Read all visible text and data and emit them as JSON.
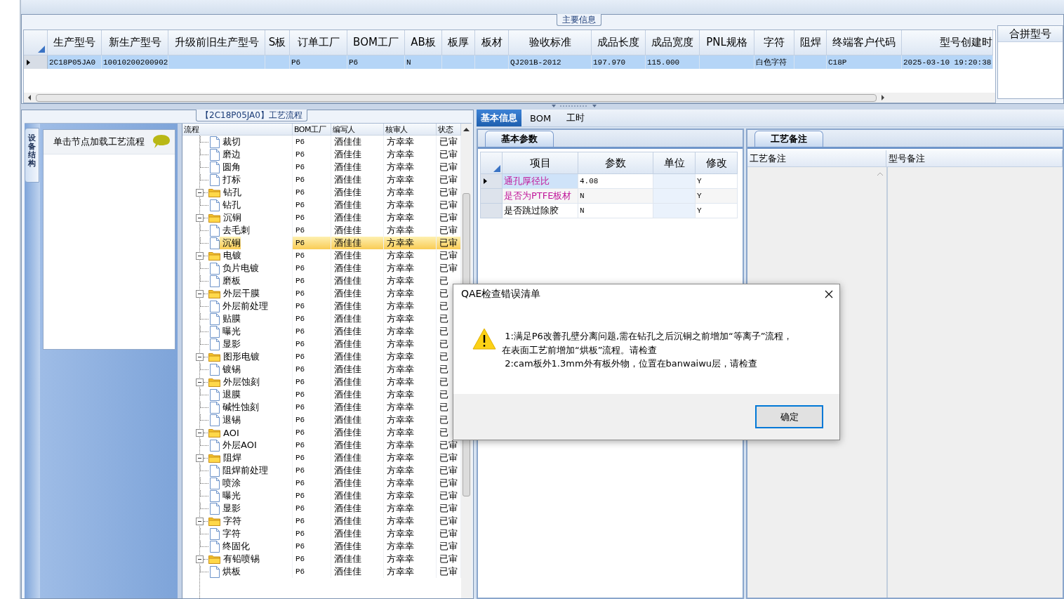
{
  "main_info": {
    "title": "主要信息",
    "columns": [
      "生产型号",
      "新生产型号",
      "升级前旧生产型号",
      "S板",
      "订单工厂",
      "BOM工厂",
      "AB板",
      "板厚",
      "板材",
      "验收标准",
      "成品长度",
      "成品宽度",
      "PNL规格",
      "字符",
      "阻焊",
      "终端客户代码",
      "型号创建时"
    ],
    "rows": [
      {
        "selected": true,
        "cells": [
          "2C18P05JA0",
          "10010200200902",
          "",
          "",
          "P6",
          "P6",
          "N",
          "",
          "",
          "QJ201B-2012",
          "197.970",
          "115.000",
          "",
          "白色字符",
          "",
          "C18P",
          "2025-03-10 19:20:38"
        ]
      }
    ],
    "merge_header": "合拼型号"
  },
  "process_panel": {
    "title": "【2C18P05JA0】工艺流程",
    "side_tab": "设备结构",
    "node_hint": "单击节点加载工艺流程",
    "columns": [
      "流程",
      "BOM工厂",
      "编写人",
      "核审人",
      "状态"
    ],
    "items": [
      {
        "children": [
          {
            "label": "裁切",
            "bom": "P6",
            "writer": "酒佳佳",
            "reviewer": "方幸幸",
            "status": "已审",
            "selected": false
          },
          {
            "label": "磨边",
            "bom": "P6",
            "writer": "酒佳佳",
            "reviewer": "方幸幸",
            "status": "已审",
            "selected": false
          },
          {
            "label": "圆角",
            "bom": "P6",
            "writer": "酒佳佳",
            "reviewer": "方幸幸",
            "status": "已审",
            "selected": false
          },
          {
            "label": "打标",
            "bom": "P6",
            "writer": "酒佳佳",
            "reviewer": "方幸幸",
            "status": "已审",
            "selected": false
          }
        ]
      },
      {
        "label": "钻孔",
        "bom": "P6",
        "writer": "酒佳佳",
        "reviewer": "方幸幸",
        "status": "已审",
        "selected": false,
        "expanded": true,
        "children": [
          {
            "label": "钻孔",
            "bom": "P6",
            "writer": "酒佳佳",
            "reviewer": "方幸幸",
            "status": "已审",
            "selected": false
          }
        ]
      },
      {
        "label": "沉铜",
        "bom": "P6",
        "writer": "酒佳佳",
        "reviewer": "方幸幸",
        "status": "已审",
        "selected": false,
        "expanded": true,
        "children": [
          {
            "label": "去毛刺",
            "bom": "P6",
            "writer": "酒佳佳",
            "reviewer": "方幸幸",
            "status": "已审",
            "selected": false
          },
          {
            "label": "沉铜",
            "bom": "P6",
            "writer": "酒佳佳",
            "reviewer": "方幸幸",
            "status": "已审",
            "selected": true
          }
        ]
      },
      {
        "label": "电镀",
        "bom": "P6",
        "writer": "酒佳佳",
        "reviewer": "方幸幸",
        "status": "已审",
        "selected": false,
        "expanded": true,
        "children": [
          {
            "label": "负片电镀",
            "bom": "P6",
            "writer": "酒佳佳",
            "reviewer": "方幸幸",
            "status": "已审",
            "selected": false
          },
          {
            "label": "磨板",
            "bom": "P6",
            "writer": "酒佳佳",
            "reviewer": "方幸幸",
            "status": "已",
            "selected": false
          }
        ]
      },
      {
        "label": "外层干膜",
        "bom": "P6",
        "writer": "酒佳佳",
        "reviewer": "方幸幸",
        "status": "已",
        "selected": false,
        "expanded": true,
        "children": [
          {
            "label": "外层前处理",
            "bom": "P6",
            "writer": "酒佳佳",
            "reviewer": "方幸幸",
            "status": "已",
            "selected": false
          },
          {
            "label": "贴膜",
            "bom": "P6",
            "writer": "酒佳佳",
            "reviewer": "方幸幸",
            "status": "已",
            "selected": false
          },
          {
            "label": "曝光",
            "bom": "P6",
            "writer": "酒佳佳",
            "reviewer": "方幸幸",
            "status": "已",
            "selected": false
          },
          {
            "label": "显影",
            "bom": "P6",
            "writer": "酒佳佳",
            "reviewer": "方幸幸",
            "status": "已",
            "selected": false
          }
        ]
      },
      {
        "label": "图形电镀",
        "bom": "P6",
        "writer": "酒佳佳",
        "reviewer": "方幸幸",
        "status": "已",
        "selected": false,
        "expanded": true,
        "children": [
          {
            "label": "镀锡",
            "bom": "P6",
            "writer": "酒佳佳",
            "reviewer": "方幸幸",
            "status": "已",
            "selected": false
          }
        ]
      },
      {
        "label": "外层蚀刻",
        "bom": "P6",
        "writer": "酒佳佳",
        "reviewer": "方幸幸",
        "status": "已",
        "selected": false,
        "expanded": true,
        "children": [
          {
            "label": "退膜",
            "bom": "P6",
            "writer": "酒佳佳",
            "reviewer": "方幸幸",
            "status": "已",
            "selected": false
          },
          {
            "label": "碱性蚀刻",
            "bom": "P6",
            "writer": "酒佳佳",
            "reviewer": "方幸幸",
            "status": "已",
            "selected": false
          },
          {
            "label": "退锡",
            "bom": "P6",
            "writer": "酒佳佳",
            "reviewer": "方幸幸",
            "status": "已",
            "selected": false
          }
        ]
      },
      {
        "label": "AOI",
        "bom": "P6",
        "writer": "酒佳佳",
        "reviewer": "方幸幸",
        "status": "已",
        "selected": false,
        "expanded": true,
        "children": [
          {
            "label": "外层AOI",
            "bom": "P6",
            "writer": "酒佳佳",
            "reviewer": "方幸幸",
            "status": "已审",
            "selected": false
          }
        ]
      },
      {
        "label": "阻焊",
        "bom": "P6",
        "writer": "酒佳佳",
        "reviewer": "方幸幸",
        "status": "已审",
        "selected": false,
        "expanded": true,
        "children": [
          {
            "label": "阻焊前处理",
            "bom": "P6",
            "writer": "酒佳佳",
            "reviewer": "方幸幸",
            "status": "已审",
            "selected": false
          },
          {
            "label": "喷涂",
            "bom": "P6",
            "writer": "酒佳佳",
            "reviewer": "方幸幸",
            "status": "已审",
            "selected": false
          },
          {
            "label": "曝光",
            "bom": "P6",
            "writer": "酒佳佳",
            "reviewer": "方幸幸",
            "status": "已审",
            "selected": false
          },
          {
            "label": "显影",
            "bom": "P6",
            "writer": "酒佳佳",
            "reviewer": "方幸幸",
            "status": "已审",
            "selected": false
          }
        ]
      },
      {
        "label": "字符",
        "bom": "P6",
        "writer": "酒佳佳",
        "reviewer": "方幸幸",
        "status": "已审",
        "selected": false,
        "expanded": true,
        "children": [
          {
            "label": "字符",
            "bom": "P6",
            "writer": "酒佳佳",
            "reviewer": "方幸幸",
            "status": "已审",
            "selected": false
          },
          {
            "label": "终固化",
            "bom": "P6",
            "writer": "酒佳佳",
            "reviewer": "方幸幸",
            "status": "已审",
            "selected": false
          }
        ]
      },
      {
        "label": "有铅喷锡",
        "bom": "P6",
        "writer": "酒佳佳",
        "reviewer": "方幸幸",
        "status": "已审",
        "selected": false,
        "expanded": true,
        "children": [
          {
            "label": "烘板",
            "bom": "P6",
            "writer": "酒佳佳",
            "reviewer": "方幸幸",
            "status": "已审",
            "selected": false
          }
        ]
      }
    ]
  },
  "detail_tabs": [
    {
      "label": "基本信息",
      "selected": true
    },
    {
      "label": "BOM",
      "selected": false
    },
    {
      "label": "工时",
      "selected": false
    }
  ],
  "basic_params": {
    "tab": "基本参数",
    "columns": [
      "项目",
      "参数",
      "单位",
      "修改"
    ],
    "rows": [
      {
        "item": "通孔厚径比",
        "value": "4.08",
        "modified": "Y",
        "flagged": true,
        "selected": true
      },
      {
        "item": "是否为PTFE板材",
        "value": "N",
        "modified": "Y",
        "flagged": true,
        "selected": false
      },
      {
        "item": "是否跳过除胶",
        "value": "N",
        "modified": "Y",
        "flagged": false,
        "selected": false
      }
    ]
  },
  "remarks": {
    "tab": "工艺备注",
    "columns": [
      "工艺备注",
      "型号备注"
    ]
  },
  "dialog": {
    "title": "QAE检查错误清单",
    "lines": [
      " 1:满足P6改善孔壁分离问题,需在钻孔之后沉铜之前增加“等离子”流程，",
      "在表面工艺前增加“烘板”流程。请检查",
      " 2:cam板外1.3mm外有板外物，位置在banwaiwu层，请检查"
    ],
    "button": "确定"
  }
}
